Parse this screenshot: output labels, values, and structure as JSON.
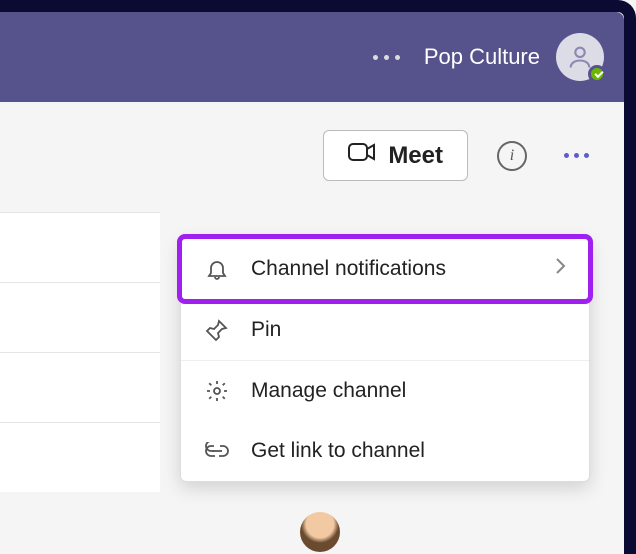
{
  "header": {
    "app_title": "Pop Culture"
  },
  "toolbar": {
    "meet_label": "Meet"
  },
  "menu": {
    "items": [
      {
        "label": "Channel notifications",
        "icon": "bell-icon",
        "has_submenu": true
      },
      {
        "label": "Pin",
        "icon": "pin-icon",
        "has_submenu": false
      },
      {
        "label": "Manage channel",
        "icon": "gear-icon",
        "has_submenu": false
      },
      {
        "label": "Get link to channel",
        "icon": "link-icon",
        "has_submenu": false
      }
    ]
  }
}
